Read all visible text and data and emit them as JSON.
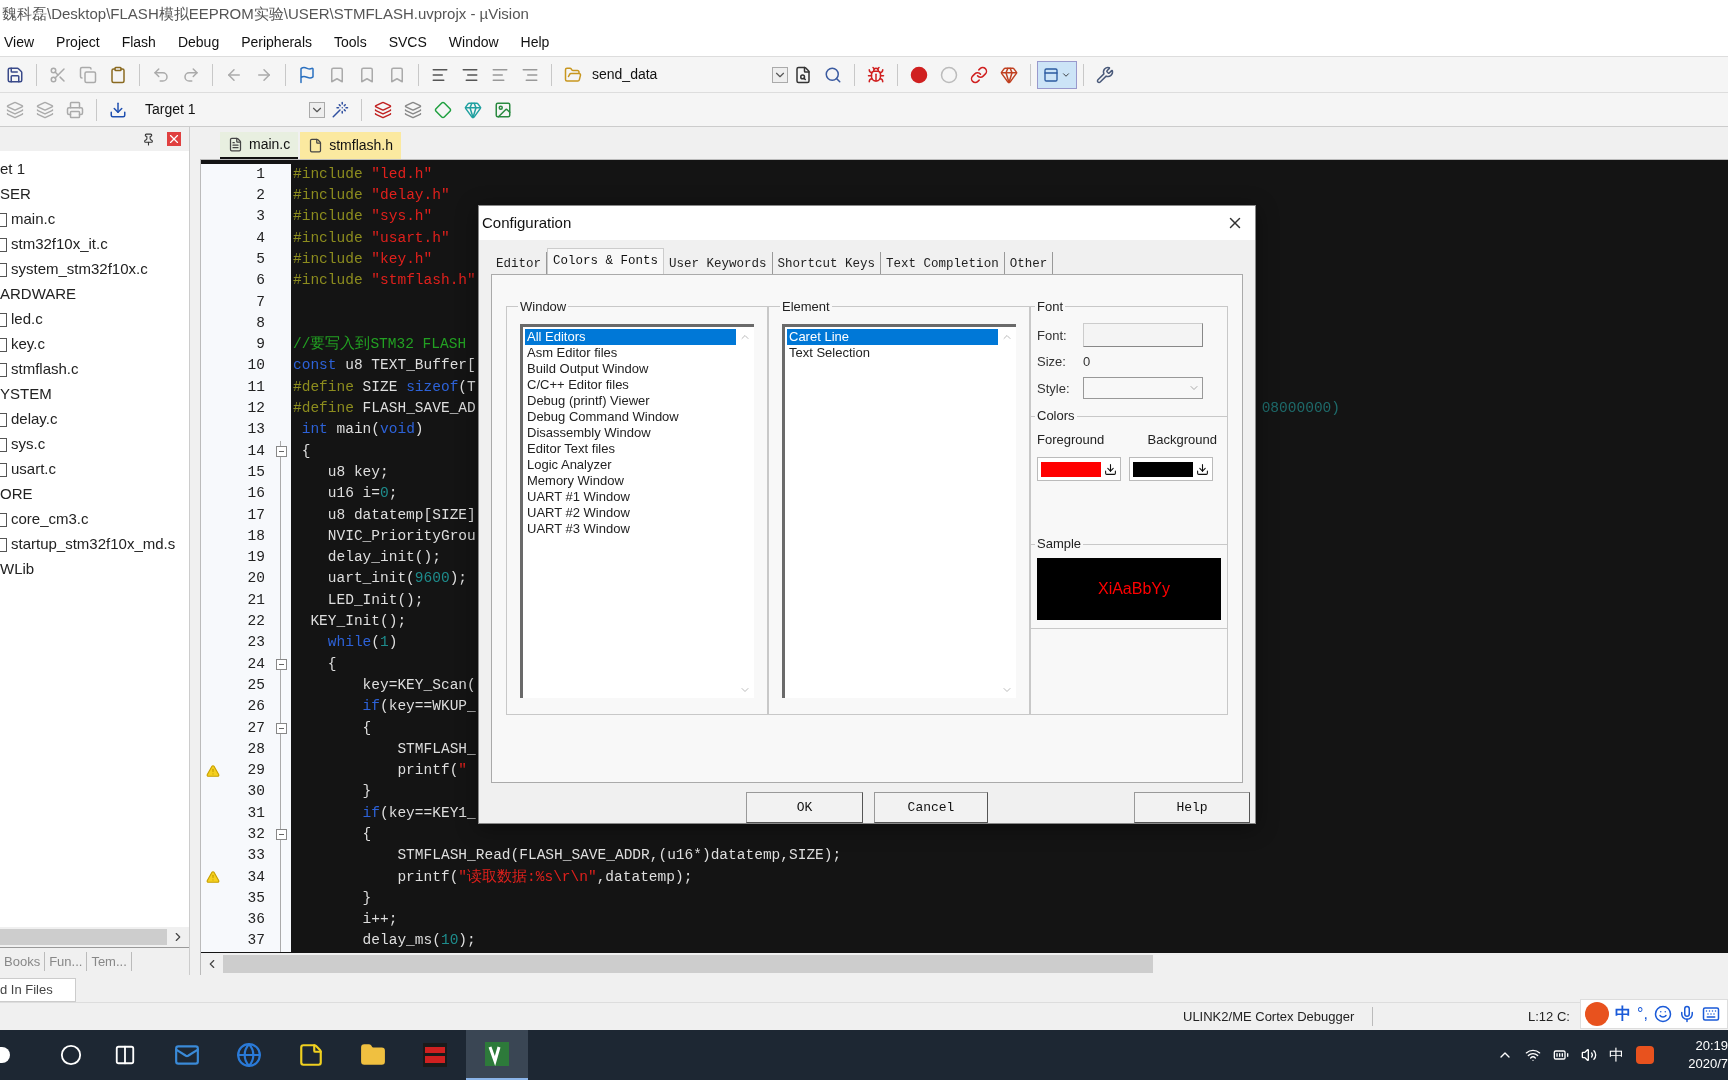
{
  "window": {
    "title": "魏科磊\\Desktop\\FLASH模拟EEPROM实验\\USER\\STMFLASH.uvprojx - µVision"
  },
  "menu": [
    "View",
    "Project",
    "Flash",
    "Debug",
    "Peripherals",
    "Tools",
    "SVCS",
    "Window",
    "Help"
  ],
  "toolbar": {
    "find_combo": "send_data",
    "target_combo": "Target 1"
  },
  "project_tree": [
    {
      "label": "et 1",
      "kind": "target",
      "children": [
        {
          "label": "SER",
          "kind": "group",
          "children": [
            {
              "label": "main.c",
              "kind": "file"
            },
            {
              "label": "stm32f10x_it.c",
              "kind": "file"
            },
            {
              "label": "system_stm32f10x.c",
              "kind": "file"
            }
          ]
        },
        {
          "label": "ARDWARE",
          "kind": "group",
          "children": [
            {
              "label": "led.c",
              "kind": "file"
            },
            {
              "label": "key.c",
              "kind": "file"
            },
            {
              "label": "stmflash.c",
              "kind": "file"
            }
          ]
        },
        {
          "label": "YSTEM",
          "kind": "group",
          "children": [
            {
              "label": "delay.c",
              "kind": "file"
            },
            {
              "label": "sys.c",
              "kind": "file"
            },
            {
              "label": "usart.c",
              "kind": "file"
            }
          ]
        },
        {
          "label": "ORE",
          "kind": "group",
          "children": [
            {
              "label": "core_cm3.c",
              "kind": "file"
            },
            {
              "label": "startup_stm32f10x_md.s",
              "kind": "file"
            }
          ]
        },
        {
          "label": "WLib",
          "kind": "group"
        }
      ]
    }
  ],
  "panel_tabs": [
    {
      "label": "Books",
      "selected": false
    },
    {
      "label": "Fun...",
      "selected": false
    },
    {
      "label": "Tem...",
      "selected": false
    }
  ],
  "editor_tabs": [
    {
      "label": "main.c",
      "selected": true
    },
    {
      "label": "stmflash.h",
      "selected": false
    }
  ],
  "code": [
    {
      "n": "1",
      "warning": false,
      "fold": false,
      "segs": [
        {
          "kind": "pre",
          "text": "#include "
        },
        {
          "kind": "str",
          "text": "\"led.h\""
        }
      ]
    },
    {
      "n": "2",
      "warning": false,
      "fold": false,
      "segs": [
        {
          "kind": "pre",
          "text": "#include "
        },
        {
          "kind": "str",
          "text": "\"delay.h\""
        }
      ]
    },
    {
      "n": "3",
      "warning": false,
      "fold": false,
      "segs": [
        {
          "kind": "pre",
          "text": "#include "
        },
        {
          "kind": "str",
          "text": "\"sys.h\""
        }
      ]
    },
    {
      "n": "4",
      "warning": false,
      "fold": false,
      "segs": [
        {
          "kind": "pre",
          "text": "#include "
        },
        {
          "kind": "str",
          "text": "\"usart.h\""
        }
      ]
    },
    {
      "n": "5",
      "warning": false,
      "fold": false,
      "segs": [
        {
          "kind": "pre",
          "text": "#include "
        },
        {
          "kind": "str",
          "text": "\"key.h\""
        }
      ]
    },
    {
      "n": "6",
      "warning": false,
      "fold": false,
      "segs": [
        {
          "kind": "pre",
          "text": "#include "
        },
        {
          "kind": "str",
          "text": "\"stmflash.h\""
        }
      ]
    },
    {
      "n": "7",
      "warning": false,
      "fold": false
    },
    {
      "n": "8",
      "warning": false,
      "fold": false
    },
    {
      "n": "9",
      "warning": false,
      "fold": false,
      "segs": [
        {
          "kind": "com",
          "text": "//要写入到STM32 FLASH"
        }
      ]
    },
    {
      "n": "10",
      "warning": false,
      "fold": false,
      "segs": [
        {
          "kind": "kw",
          "text": "const"
        },
        {
          "kind": "txt",
          "text": " u8 TEXT_Buffer["
        }
      ]
    },
    {
      "n": "11",
      "warning": false,
      "fold": false,
      "segs": [
        {
          "kind": "pre",
          "text": "#define"
        },
        {
          "kind": "txt",
          "text": " SIZE "
        },
        {
          "kind": "kw",
          "text": "sizeof"
        },
        {
          "kind": "txt",
          "text": "(T"
        }
      ]
    },
    {
      "n": "12",
      "warning": false,
      "fold": false,
      "segs": [
        {
          "kind": "pre",
          "text": "#define"
        },
        {
          "kind": "txt",
          "text": " FLASH_SAVE_AD"
        }
      ],
      "tail": "08000000)"
    },
    {
      "n": "13",
      "warning": false,
      "fold": false,
      "segs": [
        {
          "kind": "kw",
          "text": " int"
        },
        {
          "kind": "txt",
          "text": " main("
        },
        {
          "kind": "kw",
          "text": "void"
        },
        {
          "kind": "txt",
          "text": ")"
        }
      ]
    },
    {
      "n": "14",
      "warning": false,
      "fold": true,
      "segs": [
        {
          "kind": "txt",
          "text": " {"
        }
      ]
    },
    {
      "n": "15",
      "warning": false,
      "fold": false,
      "segs": [
        {
          "kind": "txt",
          "text": "    u8 key;"
        }
      ]
    },
    {
      "n": "16",
      "warning": false,
      "fold": false,
      "segs": [
        {
          "kind": "txt",
          "text": "    u16 i="
        },
        {
          "kind": "num",
          "text": "0"
        },
        {
          "kind": "txt",
          "text": ";"
        }
      ]
    },
    {
      "n": "17",
      "warning": false,
      "fold": false,
      "segs": [
        {
          "kind": "txt",
          "text": "    u8 datatemp[SIZE]"
        }
      ]
    },
    {
      "n": "18",
      "warning": false,
      "fold": false,
      "segs": [
        {
          "kind": "txt",
          "text": "    NVIC_PriorityGrou"
        }
      ]
    },
    {
      "n": "19",
      "warning": false,
      "fold": false,
      "segs": [
        {
          "kind": "txt",
          "text": "    delay_init();"
        }
      ]
    },
    {
      "n": "20",
      "warning": false,
      "fold": false,
      "segs": [
        {
          "kind": "txt",
          "text": "    uart_init("
        },
        {
          "kind": "num",
          "text": "9600"
        },
        {
          "kind": "txt",
          "text": ");"
        }
      ]
    },
    {
      "n": "21",
      "warning": false,
      "fold": false,
      "segs": [
        {
          "kind": "txt",
          "text": "    LED_Init();"
        }
      ]
    },
    {
      "n": "22",
      "warning": false,
      "fold": false,
      "segs": [
        {
          "kind": "txt",
          "text": "  KEY_Init();"
        }
      ]
    },
    {
      "n": "23",
      "warning": false,
      "fold": false,
      "segs": [
        {
          "kind": "kw",
          "text": "    while"
        },
        {
          "kind": "txt",
          "text": "("
        },
        {
          "kind": "num",
          "text": "1"
        },
        {
          "kind": "txt",
          "text": ")"
        }
      ]
    },
    {
      "n": "24",
      "warning": false,
      "fold": true,
      "segs": [
        {
          "kind": "txt",
          "text": "    {"
        }
      ]
    },
    {
      "n": "25",
      "warning": false,
      "fold": false,
      "segs": [
        {
          "kind": "txt",
          "text": "        key=KEY_Scan("
        }
      ]
    },
    {
      "n": "26",
      "warning": false,
      "fold": false,
      "segs": [
        {
          "kind": "kw",
          "text": "        if"
        },
        {
          "kind": "txt",
          "text": "(key==WKUP_"
        }
      ]
    },
    {
      "n": "27",
      "warning": false,
      "fold": true,
      "segs": [
        {
          "kind": "txt",
          "text": "        {"
        }
      ]
    },
    {
      "n": "28",
      "warning": false,
      "fold": false,
      "segs": [
        {
          "kind": "txt",
          "text": "            STMFLASH_"
        }
      ]
    },
    {
      "n": "29",
      "warning": true,
      "fold": false,
      "segs": [
        {
          "kind": "txt",
          "text": "            printf("
        },
        {
          "kind": "str",
          "text": "\""
        }
      ]
    },
    {
      "n": "30",
      "warning": false,
      "fold": false,
      "segs": [
        {
          "kind": "txt",
          "text": "        }"
        }
      ]
    },
    {
      "n": "31",
      "warning": false,
      "fold": false,
      "segs": [
        {
          "kind": "kw",
          "text": "        if"
        },
        {
          "kind": "txt",
          "text": "(key==KEY1_"
        }
      ]
    },
    {
      "n": "32",
      "warning": false,
      "fold": true,
      "segs": [
        {
          "kind": "txt",
          "text": "        {"
        }
      ]
    },
    {
      "n": "33",
      "warning": false,
      "fold": false,
      "segs": [
        {
          "kind": "txt",
          "text": "            STMFLASH_Read(FLASH_SAVE_ADDR,(u16*)datatemp,SIZE);"
        }
      ]
    },
    {
      "n": "34",
      "warning": true,
      "fold": false,
      "segs": [
        {
          "kind": "txt",
          "text": "            printf("
        },
        {
          "kind": "str",
          "text": "\"读取数据:%s\\r\\n\""
        },
        {
          "kind": "txt",
          "text": ",datatemp);"
        }
      ]
    },
    {
      "n": "35",
      "warning": false,
      "fold": false,
      "segs": [
        {
          "kind": "txt",
          "text": "        }"
        }
      ]
    },
    {
      "n": "36",
      "warning": false,
      "fold": false,
      "segs": [
        {
          "kind": "txt",
          "text": "        i++;"
        }
      ]
    },
    {
      "n": "37",
      "warning": false,
      "fold": false,
      "segs": [
        {
          "kind": "txt",
          "text": "        delay_ms("
        },
        {
          "kind": "num",
          "text": "10"
        },
        {
          "kind": "txt",
          "text": ");"
        }
      ]
    }
  ],
  "output_tab": "d In Files",
  "status_bar": {
    "debugger": "ULINK2/ME Cortex Debugger",
    "position": "L:12 C:"
  },
  "ime_bar": {
    "mode": "中",
    "punctuation": "°,"
  },
  "dialog": {
    "title": "Configuration",
    "tabs": [
      {
        "label": "Editor",
        "selected": false
      },
      {
        "label": "Colors & Fonts",
        "selected": true
      },
      {
        "label": "User Keywords",
        "selected": false
      },
      {
        "label": "Shortcut Keys",
        "selected": false
      },
      {
        "label": "Text Completion",
        "selected": false
      },
      {
        "label": "Other",
        "selected": false
      }
    ],
    "window_group": {
      "legend": "Window",
      "items": [
        {
          "label": "All Editors",
          "selected": true
        },
        {
          "label": "Asm Editor files",
          "selected": false
        },
        {
          "label": "Build Output Window",
          "selected": false
        },
        {
          "label": "C/C++ Editor files",
          "selected": false
        },
        {
          "label": "Debug (printf) Viewer",
          "selected": false
        },
        {
          "label": "Debug Command Window",
          "selected": false
        },
        {
          "label": "Disassembly Window",
          "selected": false
        },
        {
          "label": "Editor Text files",
          "selected": false
        },
        {
          "label": "Logic Analyzer",
          "selected": false
        },
        {
          "label": "Memory Window",
          "selected": false
        },
        {
          "label": "UART #1 Window",
          "selected": false
        },
        {
          "label": "UART #2 Window",
          "selected": false
        },
        {
          "label": "UART #3 Window",
          "selected": false
        }
      ]
    },
    "element_group": {
      "legend": "Element",
      "items": [
        {
          "label": "Caret Line",
          "selected": true
        },
        {
          "label": "Text Selection",
          "selected": false
        }
      ]
    },
    "font_group": {
      "legend": "Font",
      "font_label": "Font:",
      "size_label": "Size:",
      "size_value": "0",
      "style_label": "Style:",
      "colors_legend": "Colors",
      "swatches": [
        {
          "label": "Foreground",
          "color": "#ff0000"
        },
        {
          "label": "Background",
          "color": "#000000"
        }
      ],
      "sample_legend": "Sample",
      "sample_text": "XiAaBbYy"
    },
    "buttons": [
      "OK",
      "Cancel",
      "Help"
    ]
  },
  "taskbar": {
    "apps": [
      {
        "kind": "mail",
        "selected": false
      },
      {
        "kind": "browser",
        "selected": false
      },
      {
        "kind": "notes",
        "selected": false
      },
      {
        "kind": "folder",
        "selected": false
      },
      {
        "kind": "atk",
        "selected": false
      },
      {
        "kind": "keil",
        "selected": true
      }
    ],
    "input_language": "中",
    "time": "20:19",
    "date": "2020/7"
  }
}
